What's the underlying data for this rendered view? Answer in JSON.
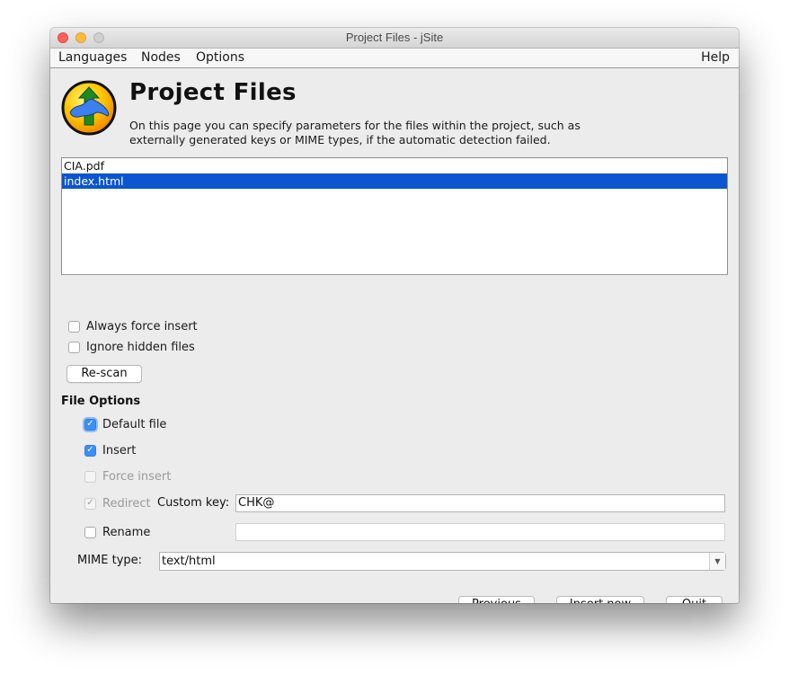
{
  "window": {
    "title": "Project Files - jSite"
  },
  "menubar": {
    "items": [
      "Languages",
      "Nodes",
      "Options"
    ],
    "help": "Help"
  },
  "header": {
    "logo_icon": "jsite-logo-icon",
    "title": "Project Files",
    "description_line1": "On this page you can specify parameters for the files within the project, such as",
    "description_line2": "externally generated keys or MIME types, if the automatic detection failed."
  },
  "file_list": {
    "items": [
      {
        "name": "CIA.pdf",
        "selected": false
      },
      {
        "name": "index.html",
        "selected": true
      }
    ],
    "selection_color": "#0a55d0"
  },
  "global_options": {
    "always_force_insert": {
      "label": "Always force insert",
      "checked": false
    },
    "ignore_hidden_files": {
      "label": "Ignore hidden files",
      "checked": false
    },
    "rescan_label": "Re-scan"
  },
  "file_options": {
    "title": "File Options",
    "default_file": {
      "label": "Default file",
      "checked": true,
      "enabled": true
    },
    "insert": {
      "label": "Insert",
      "checked": true,
      "enabled": true
    },
    "force_insert": {
      "label": "Force insert",
      "checked": false,
      "enabled": false
    },
    "redirect": {
      "label": "Redirect",
      "checked": true,
      "enabled": false
    },
    "custom_key_label": "Custom key:",
    "custom_key_value": "CHK@",
    "rename": {
      "label": "Rename",
      "checked": false,
      "enabled": true
    },
    "rename_value": "",
    "mime_label": "MIME type:",
    "mime_value": "text/html"
  },
  "footer": {
    "previous": "Previous",
    "insert_now": "Insert now",
    "quit": "Quit"
  },
  "colors": {
    "accent": "#3d8ef5",
    "window_bg": "#ececec"
  }
}
